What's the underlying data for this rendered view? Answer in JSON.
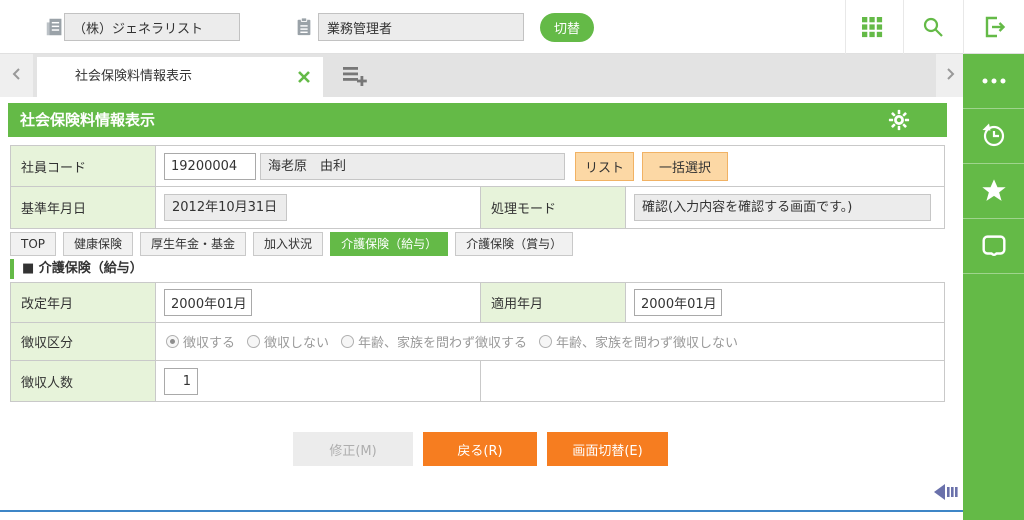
{
  "theme": {
    "green": "#64ba47",
    "label_bg": "#e7f3da",
    "orange": "#f67d20",
    "peach": "#fcd8a5",
    "peach_border": "#f1b264",
    "blue_line": "#3e86c7",
    "arrow": "#6a71ab"
  },
  "topbar": {
    "company_value": "（株）ジェネラリスト",
    "role_value": "業務管理者",
    "switch_button": "切替",
    "icons": [
      "building-icon",
      "clipboard-icon",
      "apps-grid-icon",
      "search-icon",
      "logout-icon"
    ]
  },
  "tabbar": {
    "tab_title": "社会保険料情報表示"
  },
  "header": {
    "title": "社会保険料情報表示"
  },
  "employee": {
    "label": "社員コード",
    "code": "19200004",
    "name": "海老原　由利",
    "list_button": "リスト",
    "bulk_select_button": "一括選択"
  },
  "base_date": {
    "label": "基準年月日",
    "value": "2012年10月31日"
  },
  "process_mode": {
    "label": "処理モード",
    "value": "確認(入力内容を確認する画面です。)"
  },
  "subtabs": {
    "items": [
      {
        "label": "TOP",
        "active": false
      },
      {
        "label": "健康保険",
        "active": false
      },
      {
        "label": "厚生年金・基金",
        "active": false
      },
      {
        "label": "加入状況",
        "active": false
      },
      {
        "label": "介護保険（給与）",
        "active": true
      },
      {
        "label": "介護保険（賞与）",
        "active": false
      }
    ]
  },
  "section": {
    "title": "■ 介護保険（給与）"
  },
  "kaigo": {
    "revision_label": "改定年月",
    "revision_value": "2000年01月",
    "apply_label": "適用年月",
    "apply_value": "2000年01月",
    "collection_label": "徴収区分",
    "radio_options": [
      "徴収する",
      "徴収しない",
      "年齢、家族を問わず徴収する",
      "年齢、家族を問わず徴収しない"
    ],
    "selected_index": 0,
    "count_label": "徴収人数",
    "count_value": "1"
  },
  "footer_buttons": {
    "modify": "修正(M)",
    "back": "戻る(R)",
    "switch_screen": "画面切替(E)"
  },
  "sidebar": {
    "icons": [
      "more-icon",
      "history-icon",
      "star-icon",
      "memo-icon"
    ]
  }
}
